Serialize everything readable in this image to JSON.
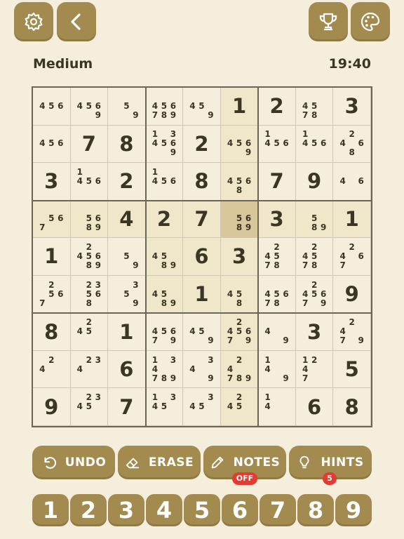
{
  "header": {
    "settings_icon": "gear-icon",
    "back_icon": "chevron-left-icon",
    "trophy_icon": "trophy-icon",
    "palette_icon": "palette-icon"
  },
  "status": {
    "difficulty": "Medium",
    "timer": "19:40"
  },
  "selected_cell": {
    "row": 3,
    "col": 5
  },
  "board": [
    [
      {
        "n": [
          4,
          5,
          6
        ]
      },
      {
        "n": [
          4,
          5,
          6,
          9
        ]
      },
      {
        "n": [
          5,
          9
        ]
      },
      {
        "n": [
          4,
          5,
          6,
          7,
          8,
          9
        ]
      },
      {
        "n": [
          4,
          5,
          9
        ]
      },
      {
        "v": 1
      },
      {
        "v": 2
      },
      {
        "n": [
          4,
          5,
          7,
          8
        ]
      },
      {
        "v": 3
      }
    ],
    [
      {
        "n": [
          4,
          5,
          6
        ]
      },
      {
        "v": 7
      },
      {
        "v": 8
      },
      {
        "n": [
          1,
          3,
          4,
          5,
          6,
          9
        ]
      },
      {
        "v": 2
      },
      {
        "n": [
          4,
          5,
          6,
          9
        ]
      },
      {
        "n": [
          1,
          4,
          5,
          6
        ]
      },
      {
        "n": [
          1,
          4,
          5,
          6
        ]
      },
      {
        "n": [
          2,
          4,
          6,
          8
        ]
      }
    ],
    [
      {
        "v": 3
      },
      {
        "n": [
          1,
          4,
          5,
          6
        ]
      },
      {
        "v": 2
      },
      {
        "n": [
          1,
          4,
          5,
          6
        ]
      },
      {
        "v": 8
      },
      {
        "n": [
          4,
          5,
          6,
          8
        ]
      },
      {
        "v": 7
      },
      {
        "v": 9
      },
      {
        "n": [
          4,
          6
        ]
      }
    ],
    [
      {
        "n": [
          5,
          6,
          7
        ]
      },
      {
        "n": [
          5,
          6,
          8,
          9
        ]
      },
      {
        "v": 4
      },
      {
        "v": 2
      },
      {
        "v": 7
      },
      {
        "n": [
          5,
          6,
          8,
          9
        ]
      },
      {
        "v": 3
      },
      {
        "n": [
          5,
          8,
          9
        ]
      },
      {
        "v": 1
      }
    ],
    [
      {
        "v": 1
      },
      {
        "n": [
          2,
          4,
          5,
          6,
          8,
          9
        ]
      },
      {
        "n": [
          5,
          9
        ]
      },
      {
        "n": [
          4,
          5,
          8,
          9
        ]
      },
      {
        "v": 6
      },
      {
        "v": 3
      },
      {
        "n": [
          2,
          4,
          5,
          7,
          8
        ]
      },
      {
        "n": [
          2,
          4,
          5,
          7,
          8
        ]
      },
      {
        "n": [
          2,
          4,
          6,
          7
        ]
      }
    ],
    [
      {
        "n": [
          2,
          5,
          6,
          7
        ]
      },
      {
        "n": [
          2,
          3,
          5,
          6,
          8
        ]
      },
      {
        "n": [
          3,
          5,
          9
        ]
      },
      {
        "n": [
          4,
          5,
          8,
          9
        ]
      },
      {
        "v": 1
      },
      {
        "n": [
          4,
          5,
          8
        ]
      },
      {
        "n": [
          4,
          5,
          6,
          7,
          8
        ]
      },
      {
        "n": [
          2,
          4,
          5,
          6,
          7,
          9
        ]
      },
      {
        "v": 9
      }
    ],
    [
      {
        "v": 8
      },
      {
        "n": [
          2,
          4,
          5
        ]
      },
      {
        "v": 1
      },
      {
        "n": [
          4,
          5,
          6,
          7,
          9
        ]
      },
      {
        "n": [
          4,
          5,
          9
        ]
      },
      {
        "n": [
          2,
          4,
          5,
          6,
          7,
          9
        ]
      },
      {
        "n": [
          4,
          9
        ]
      },
      {
        "v": 3
      },
      {
        "n": [
          2,
          4,
          7,
          9
        ]
      }
    ],
    [
      {
        "n": [
          2,
          4
        ]
      },
      {
        "n": [
          2,
          3,
          4
        ]
      },
      {
        "v": 6
      },
      {
        "n": [
          1,
          3,
          4,
          7,
          8,
          9
        ]
      },
      {
        "n": [
          3,
          4,
          9
        ]
      },
      {
        "n": [
          2,
          4,
          7,
          8,
          9
        ]
      },
      {
        "n": [
          1,
          4,
          9
        ]
      },
      {
        "n": [
          1,
          2,
          4,
          7
        ]
      },
      {
        "v": 5
      }
    ],
    [
      {
        "v": 9
      },
      {
        "n": [
          2,
          3,
          4,
          5
        ]
      },
      {
        "v": 7
      },
      {
        "n": [
          1,
          3,
          4,
          5
        ]
      },
      {
        "n": [
          3,
          4,
          5
        ]
      },
      {
        "n": [
          2,
          4,
          5
        ]
      },
      {
        "n": [
          1,
          4
        ]
      },
      {
        "v": 6
      },
      {
        "v": 8
      }
    ]
  ],
  "actions": {
    "undo": {
      "label": "UNDO",
      "icon": "undo-icon"
    },
    "erase": {
      "label": "ERASE",
      "icon": "eraser-icon"
    },
    "notes": {
      "label": "NOTES",
      "icon": "pencil-icon",
      "badge": "OFF"
    },
    "hints": {
      "label": "HINTS",
      "icon": "lightbulb-icon",
      "badge": "5"
    }
  },
  "numpad": [
    "1",
    "2",
    "3",
    "4",
    "5",
    "6",
    "7",
    "8",
    "9"
  ],
  "colors": {
    "background": "#f5eedc",
    "accent": "#a38a4f",
    "highlight": "#f0e6c9",
    "selected": "#d8c79a",
    "badge": "#e23b32"
  }
}
